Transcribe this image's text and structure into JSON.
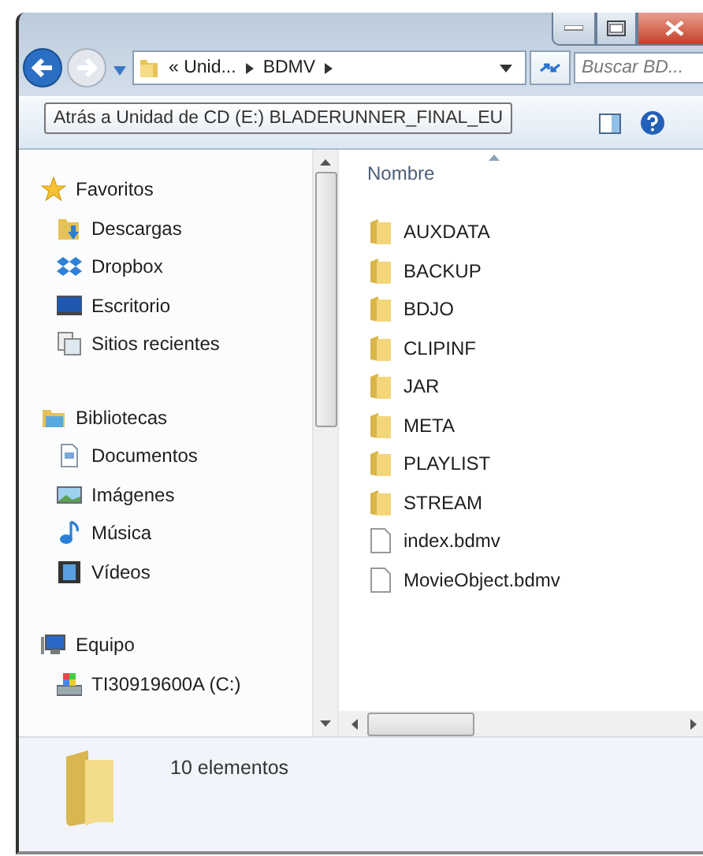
{
  "address": {
    "crumbs": [
      "« Unid...",
      "BDMV"
    ]
  },
  "search": {
    "placeholder": "Buscar BD..."
  },
  "tooltip": "Atrás a Unidad de CD (E:) BLADERUNNER_FINAL_EU",
  "sidebar": {
    "groups": [
      {
        "label": "Favoritos",
        "kind": "star",
        "children": [
          {
            "label": "Descargas",
            "kind": "downloads"
          },
          {
            "label": "Dropbox",
            "kind": "dropbox"
          },
          {
            "label": "Escritorio",
            "kind": "desktop"
          },
          {
            "label": "Sitios recientes",
            "kind": "recent"
          }
        ]
      },
      {
        "label": "Bibliotecas",
        "kind": "library",
        "children": [
          {
            "label": "Documentos",
            "kind": "document"
          },
          {
            "label": "Imágenes",
            "kind": "pictures"
          },
          {
            "label": "Música",
            "kind": "music"
          },
          {
            "label": "Vídeos",
            "kind": "video"
          }
        ]
      },
      {
        "label": "Equipo",
        "kind": "computer",
        "children": [
          {
            "label": "TI30919600A (C:)",
            "kind": "drive"
          }
        ]
      }
    ]
  },
  "table": {
    "columns": [
      "Nombre"
    ],
    "rows": [
      {
        "name": "AUXDATA",
        "kind": "folder"
      },
      {
        "name": "BACKUP",
        "kind": "folder"
      },
      {
        "name": "BDJO",
        "kind": "folder"
      },
      {
        "name": "CLIPINF",
        "kind": "folder"
      },
      {
        "name": "JAR",
        "kind": "folder"
      },
      {
        "name": "META",
        "kind": "folder"
      },
      {
        "name": "PLAYLIST",
        "kind": "folder"
      },
      {
        "name": "STREAM",
        "kind": "folder"
      },
      {
        "name": "index.bdmv",
        "kind": "file"
      },
      {
        "name": "MovieObject.bdmv",
        "kind": "file"
      }
    ]
  },
  "status_bar": {
    "count": "10 elementos"
  }
}
